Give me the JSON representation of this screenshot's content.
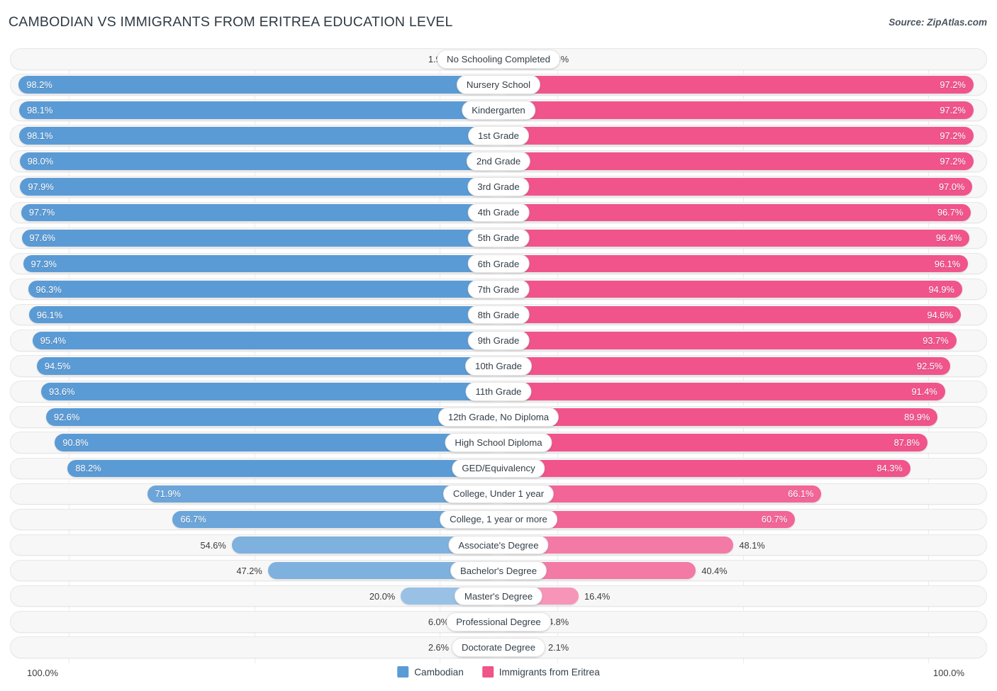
{
  "header": {
    "title": "CAMBODIAN VS IMMIGRANTS FROM ERITREA EDUCATION LEVEL",
    "source": "Source: ZipAtlas.com"
  },
  "footer": {
    "axis_left": "100.0%",
    "axis_right": "100.0%"
  },
  "legend": [
    {
      "label": "Cambodian",
      "color": "#5B9BD5"
    },
    {
      "label": "Immigrants from Eritrea",
      "color": "#F0548B"
    }
  ],
  "colors": {
    "left_accent": "#5B9BD5",
    "right_accent": "#F0548B",
    "track": "#f7f7f7",
    "text": "#34404a"
  },
  "chart_data": {
    "type": "bar",
    "title": "CAMBODIAN VS IMMIGRANTS FROM ERITREA EDUCATION LEVEL",
    "subtitle": "",
    "xlabel": "",
    "ylabel": "",
    "orientation": "horizontal-diverging",
    "axis_max": 100.0,
    "grid": true,
    "legend_position": "bottom-center",
    "categories": [
      "No Schooling Completed",
      "Nursery School",
      "Kindergarten",
      "1st Grade",
      "2nd Grade",
      "3rd Grade",
      "4th Grade",
      "5th Grade",
      "6th Grade",
      "7th Grade",
      "8th Grade",
      "9th Grade",
      "10th Grade",
      "11th Grade",
      "12th Grade, No Diploma",
      "High School Diploma",
      "GED/Equivalency",
      "College, Under 1 year",
      "College, 1 year or more",
      "Associate's Degree",
      "Bachelor's Degree",
      "Master's Degree",
      "Professional Degree",
      "Doctorate Degree"
    ],
    "series": [
      {
        "name": "Cambodian",
        "color": "#5B9BD5",
        "side": "left",
        "values": [
          1.9,
          98.2,
          98.1,
          98.1,
          98.0,
          97.9,
          97.7,
          97.6,
          97.3,
          96.3,
          96.1,
          95.4,
          94.5,
          93.6,
          92.6,
          90.8,
          88.2,
          71.9,
          66.7,
          54.6,
          47.2,
          20.0,
          6.0,
          2.6
        ],
        "labels": [
          "1.9%",
          "98.2%",
          "98.1%",
          "98.1%",
          "98.0%",
          "97.9%",
          "97.7%",
          "97.6%",
          "97.3%",
          "96.3%",
          "96.1%",
          "95.4%",
          "94.5%",
          "93.6%",
          "92.6%",
          "90.8%",
          "88.2%",
          "71.9%",
          "66.7%",
          "54.6%",
          "47.2%",
          "20.0%",
          "6.0%",
          "2.6%"
        ]
      },
      {
        "name": "Immigrants from Eritrea",
        "color": "#F0548B",
        "side": "right",
        "values": [
          2.8,
          97.2,
          97.2,
          97.2,
          97.2,
          97.0,
          96.7,
          96.4,
          96.1,
          94.9,
          94.6,
          93.7,
          92.5,
          91.4,
          89.9,
          87.8,
          84.3,
          66.1,
          60.7,
          48.1,
          40.4,
          16.4,
          4.8,
          2.1
        ],
        "labels": [
          "2.8%",
          "97.2%",
          "97.2%",
          "97.2%",
          "97.2%",
          "97.0%",
          "96.7%",
          "96.4%",
          "96.1%",
          "94.9%",
          "94.6%",
          "93.7%",
          "92.5%",
          "91.4%",
          "89.9%",
          "87.8%",
          "84.3%",
          "66.1%",
          "60.7%",
          "48.1%",
          "40.4%",
          "16.4%",
          "4.8%",
          "2.1%"
        ]
      }
    ]
  }
}
